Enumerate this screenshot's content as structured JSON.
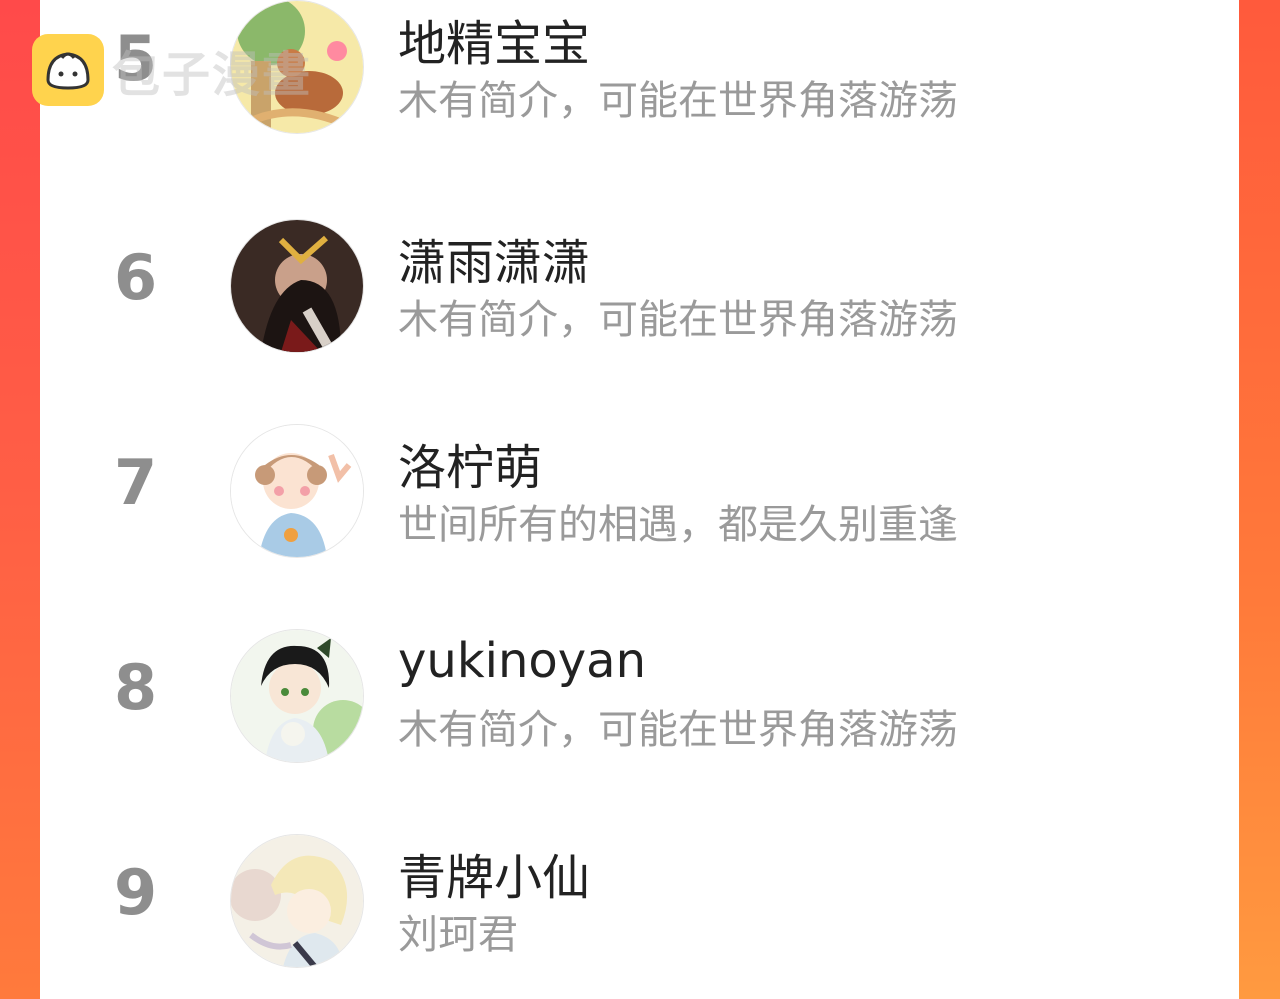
{
  "watermark": {
    "text": "包子漫畫"
  },
  "ranking": [
    {
      "rank": "5",
      "username": "地精宝宝",
      "bio": "木有简介，可能在世界角落游荡"
    },
    {
      "rank": "6",
      "username": "潇雨潇潇",
      "bio": "木有简介，可能在世界角落游荡"
    },
    {
      "rank": "7",
      "username": "洛柠萌",
      "bio": "世间所有的相遇，都是久别重逢"
    },
    {
      "rank": "8",
      "username": "yukinoyan",
      "bio": "木有简介，可能在世界角落游荡"
    },
    {
      "rank": "9",
      "username": "青牌小仙",
      "bio": "刘珂君"
    }
  ],
  "colors": {
    "accent": "#ff5a3c",
    "rank_text": "#8e8e8e",
    "bio_text": "#9a9a9a",
    "name_text": "#222222"
  }
}
